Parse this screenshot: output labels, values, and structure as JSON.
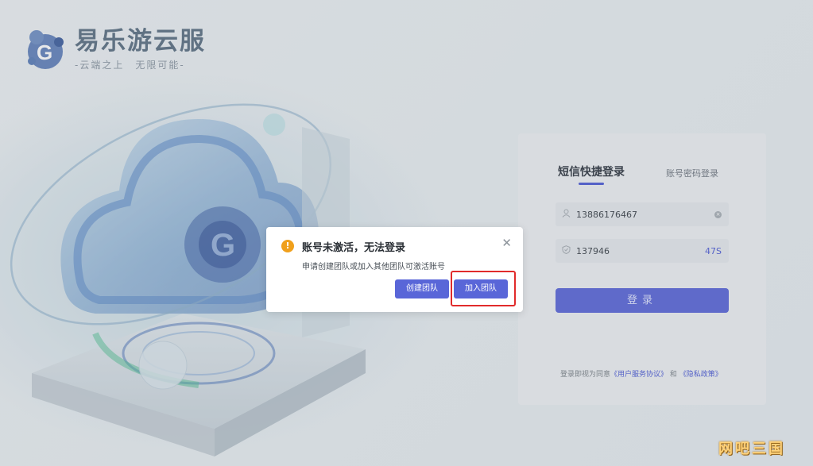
{
  "brand": {
    "title": "易乐游云服",
    "slogan": "-云端之上　无限可能-"
  },
  "login": {
    "tab_sms": "短信快捷登录",
    "tab_password": "账号密码登录",
    "phone_value": "13886176467",
    "code_value": "137946",
    "countdown": "47S",
    "login_button": "登录",
    "agreement_prefix": "登录即视为同意",
    "agreement_terms": "《用户服务协议》",
    "agreement_and": "和",
    "agreement_privacy": "《隐私政策》"
  },
  "dialog": {
    "title": "账号未激活，无法登录",
    "message": "申请创建团队或加入其他团队可激活账号",
    "create_team": "创建团队",
    "join_team": "加入团队",
    "close_symbol": "✕",
    "warn_symbol": "!"
  },
  "watermark": "网吧三国",
  "colors": {
    "accent": "#5966d8",
    "warning": "#f0a01c",
    "highlight": "#e12b2b"
  }
}
